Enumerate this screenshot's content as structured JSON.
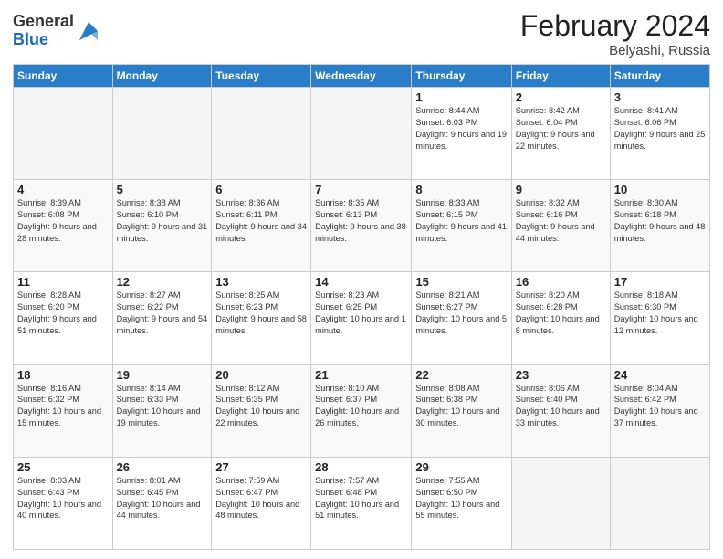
{
  "header": {
    "logo_general": "General",
    "logo_blue": "Blue",
    "title": "February 2024",
    "subtitle": "Belyashi, Russia"
  },
  "days_of_week": [
    "Sunday",
    "Monday",
    "Tuesday",
    "Wednesday",
    "Thursday",
    "Friday",
    "Saturday"
  ],
  "weeks": [
    [
      {
        "num": "",
        "info": "",
        "empty": true
      },
      {
        "num": "",
        "info": "",
        "empty": true
      },
      {
        "num": "",
        "info": "",
        "empty": true
      },
      {
        "num": "",
        "info": "",
        "empty": true
      },
      {
        "num": "1",
        "info": "Sunrise: 8:44 AM\nSunset: 6:03 PM\nDaylight: 9 hours and 19 minutes."
      },
      {
        "num": "2",
        "info": "Sunrise: 8:42 AM\nSunset: 6:04 PM\nDaylight: 9 hours and 22 minutes."
      },
      {
        "num": "3",
        "info": "Sunrise: 8:41 AM\nSunset: 6:06 PM\nDaylight: 9 hours and 25 minutes."
      }
    ],
    [
      {
        "num": "4",
        "info": "Sunrise: 8:39 AM\nSunset: 6:08 PM\nDaylight: 9 hours and 28 minutes."
      },
      {
        "num": "5",
        "info": "Sunrise: 8:38 AM\nSunset: 6:10 PM\nDaylight: 9 hours and 31 minutes."
      },
      {
        "num": "6",
        "info": "Sunrise: 8:36 AM\nSunset: 6:11 PM\nDaylight: 9 hours and 34 minutes."
      },
      {
        "num": "7",
        "info": "Sunrise: 8:35 AM\nSunset: 6:13 PM\nDaylight: 9 hours and 38 minutes."
      },
      {
        "num": "8",
        "info": "Sunrise: 8:33 AM\nSunset: 6:15 PM\nDaylight: 9 hours and 41 minutes."
      },
      {
        "num": "9",
        "info": "Sunrise: 8:32 AM\nSunset: 6:16 PM\nDaylight: 9 hours and 44 minutes."
      },
      {
        "num": "10",
        "info": "Sunrise: 8:30 AM\nSunset: 6:18 PM\nDaylight: 9 hours and 48 minutes."
      }
    ],
    [
      {
        "num": "11",
        "info": "Sunrise: 8:28 AM\nSunset: 6:20 PM\nDaylight: 9 hours and 51 minutes."
      },
      {
        "num": "12",
        "info": "Sunrise: 8:27 AM\nSunset: 6:22 PM\nDaylight: 9 hours and 54 minutes."
      },
      {
        "num": "13",
        "info": "Sunrise: 8:25 AM\nSunset: 6:23 PM\nDaylight: 9 hours and 58 minutes."
      },
      {
        "num": "14",
        "info": "Sunrise: 8:23 AM\nSunset: 6:25 PM\nDaylight: 10 hours and 1 minute."
      },
      {
        "num": "15",
        "info": "Sunrise: 8:21 AM\nSunset: 6:27 PM\nDaylight: 10 hours and 5 minutes."
      },
      {
        "num": "16",
        "info": "Sunrise: 8:20 AM\nSunset: 6:28 PM\nDaylight: 10 hours and 8 minutes."
      },
      {
        "num": "17",
        "info": "Sunrise: 8:18 AM\nSunset: 6:30 PM\nDaylight: 10 hours and 12 minutes."
      }
    ],
    [
      {
        "num": "18",
        "info": "Sunrise: 8:16 AM\nSunset: 6:32 PM\nDaylight: 10 hours and 15 minutes."
      },
      {
        "num": "19",
        "info": "Sunrise: 8:14 AM\nSunset: 6:33 PM\nDaylight: 10 hours and 19 minutes."
      },
      {
        "num": "20",
        "info": "Sunrise: 8:12 AM\nSunset: 6:35 PM\nDaylight: 10 hours and 22 minutes."
      },
      {
        "num": "21",
        "info": "Sunrise: 8:10 AM\nSunset: 6:37 PM\nDaylight: 10 hours and 26 minutes."
      },
      {
        "num": "22",
        "info": "Sunrise: 8:08 AM\nSunset: 6:38 PM\nDaylight: 10 hours and 30 minutes."
      },
      {
        "num": "23",
        "info": "Sunrise: 8:06 AM\nSunset: 6:40 PM\nDaylight: 10 hours and 33 minutes."
      },
      {
        "num": "24",
        "info": "Sunrise: 8:04 AM\nSunset: 6:42 PM\nDaylight: 10 hours and 37 minutes."
      }
    ],
    [
      {
        "num": "25",
        "info": "Sunrise: 8:03 AM\nSunset: 6:43 PM\nDaylight: 10 hours and 40 minutes."
      },
      {
        "num": "26",
        "info": "Sunrise: 8:01 AM\nSunset: 6:45 PM\nDaylight: 10 hours and 44 minutes."
      },
      {
        "num": "27",
        "info": "Sunrise: 7:59 AM\nSunset: 6:47 PM\nDaylight: 10 hours and 48 minutes."
      },
      {
        "num": "28",
        "info": "Sunrise: 7:57 AM\nSunset: 6:48 PM\nDaylight: 10 hours and 51 minutes."
      },
      {
        "num": "29",
        "info": "Sunrise: 7:55 AM\nSunset: 6:50 PM\nDaylight: 10 hours and 55 minutes."
      },
      {
        "num": "",
        "info": "",
        "empty": true
      },
      {
        "num": "",
        "info": "",
        "empty": true
      }
    ]
  ]
}
